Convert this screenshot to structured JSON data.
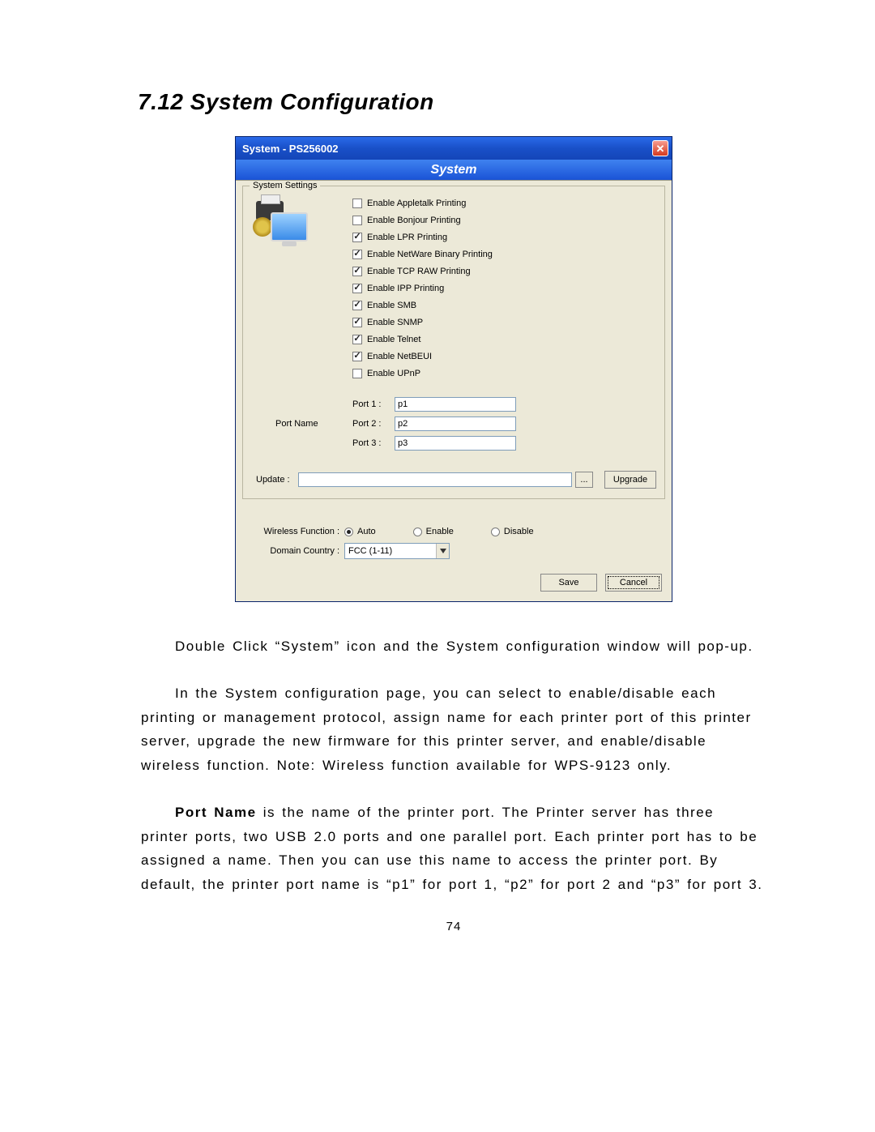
{
  "heading": "7.12   System Configuration",
  "window": {
    "titlebar": "System - PS256002",
    "banner": "System",
    "fieldset_legend": "System Settings",
    "checkboxes": [
      {
        "label": "Enable Appletalk Printing",
        "checked": false
      },
      {
        "label": "Enable Bonjour Printing",
        "checked": false
      },
      {
        "label": "Enable LPR Printing",
        "checked": true
      },
      {
        "label": "Enable NetWare Binary Printing",
        "checked": true
      },
      {
        "label": "Enable TCP RAW Printing",
        "checked": true
      },
      {
        "label": "Enable IPP Printing",
        "checked": true
      },
      {
        "label": "Enable SMB",
        "checked": true
      },
      {
        "label": "Enable SNMP",
        "checked": true
      },
      {
        "label": "Enable Telnet",
        "checked": true
      },
      {
        "label": "Enable NetBEUI",
        "checked": true
      },
      {
        "label": "Enable UPnP",
        "checked": false
      }
    ],
    "port_name_label": "Port Name",
    "ports": [
      {
        "label": "Port 1 :",
        "value": "p1"
      },
      {
        "label": "Port 2 :",
        "value": "p2"
      },
      {
        "label": "Port 3 :",
        "value": "p3"
      }
    ],
    "update_label": "Update :",
    "browse_label": "...",
    "upgrade_label": "Upgrade",
    "wireless_label": "Wireless Function :",
    "wireless_options": [
      {
        "label": "Auto",
        "selected": true
      },
      {
        "label": "Enable",
        "selected": false
      },
      {
        "label": "Disable",
        "selected": false
      }
    ],
    "domain_label": "Domain Country :",
    "domain_value": "FCC (1-11)",
    "save_label": "Save",
    "cancel_label": "Cancel"
  },
  "body": {
    "p1": "Double Click “System” icon and the System configuration window will pop-up.",
    "p2": "In the System configuration page, you can select to enable/disable each printing or management protocol, assign name for each printer port of this printer server, upgrade the new firmware for this printer server, and enable/disable wireless function. Note: Wireless function available for WPS-9123 only.",
    "p3_bold": "Port Name",
    "p3_rest": " is the name of the printer port. The Printer server has three printer ports, two USB 2.0 ports and one parallel port. Each printer port has to be assigned a name. Then you can use this name to access the printer port. By default, the printer port name is “p1” for port 1, “p2” for port 2 and “p3” for port 3."
  },
  "page_number": "74"
}
